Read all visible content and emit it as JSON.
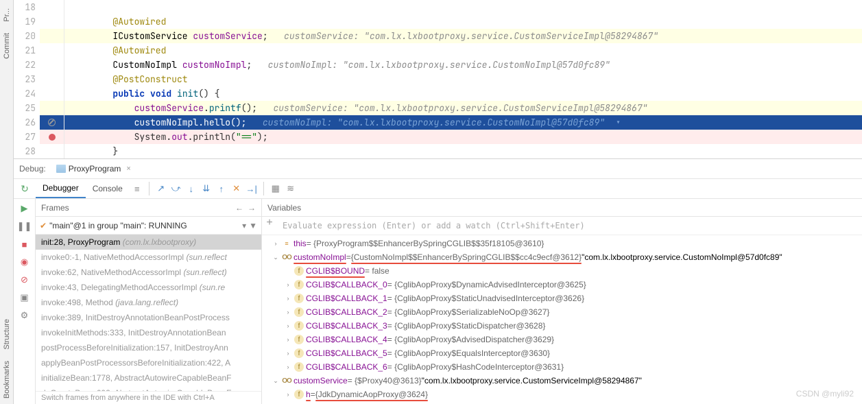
{
  "editor": {
    "lines": [
      {
        "num": "18",
        "html": ""
      },
      {
        "num": "19",
        "html": "        <span class='anno'>@Autowired</span>"
      },
      {
        "num": "20",
        "html": "        <span class='type'>ICustomService</span> <span class='field'>customService</span>;   <span class='comment-hint'>customService: \"com.lx.lxbootproxy.service.CustomServiceImpl@58294867\"</span>",
        "yellow": true
      },
      {
        "num": "21",
        "html": "        <span class='anno'>@Autowired</span>"
      },
      {
        "num": "22",
        "html": "        <span class='type'>CustomNoImpl</span> <span class='field'>customNoImpl</span>;   <span class='comment-hint'>customNoImpl: \"com.lx.lxbootproxy.service.CustomNoImpl@57d0fc89\"</span>"
      },
      {
        "num": "23",
        "html": "        <span class='anno'>@PostConstruct</span>"
      },
      {
        "num": "24",
        "html": "        <span class='kw'>public</span> <span class='kw'>void</span> <span class='mtd'>init</span>() {"
      },
      {
        "num": "25",
        "html": "            <span class='field'>customService</span>.<span class='mtd'>printf</span>();   <span class='comment-hint'>customService: \"com.lx.lxbootproxy.service.CustomServiceImpl@58294867\"</span>",
        "yellow": true
      },
      {
        "num": "26",
        "html": "            <span class='field'>customNoImpl</span>.<span class='mtd'>hello</span>();   <span class='comment-hint'>customNoImpl: \"com.lx.lxbootproxy.service.CustomNoImpl@57d0fc89\"  ▾</span>",
        "hl": true,
        "icon": "noentry"
      },
      {
        "num": "27",
        "html": "            System.<span class='field'>out</span>.println(<span class='str'>\"==\"</span>);",
        "red": true,
        "icon": "bp"
      },
      {
        "num": "28",
        "html": "        }"
      }
    ]
  },
  "sidebar": {
    "top": [
      "Pr...",
      "Commit"
    ],
    "bottom": [
      "Structure",
      "Bookmarks"
    ]
  },
  "debug": {
    "label": "Debug:",
    "tab_name": "ProxyProgram",
    "tabs": {
      "debugger": "Debugger",
      "console": "Console"
    },
    "frames_title": "Frames",
    "vars_title": "Variables",
    "thread": "\"main\"@1 in group \"main\": RUNNING",
    "eval_hint": "Evaluate expression (Enter) or add a watch (Ctrl+Shift+Enter)",
    "frames": [
      {
        "txt": "init:28, ProxyProgram ",
        "pkg": "(com.lx.lxbootproxy)",
        "sel": true
      },
      {
        "txt": "invoke0:-1, NativeMethodAccessorImpl ",
        "pkg": "(sun.reflect",
        "dim": true
      },
      {
        "txt": "invoke:62, NativeMethodAccessorImpl ",
        "pkg": "(sun.reflect)",
        "dim": true
      },
      {
        "txt": "invoke:43, DelegatingMethodAccessorImpl ",
        "pkg": "(sun.re",
        "dim": true
      },
      {
        "txt": "invoke:498, Method ",
        "pkg": "(java.lang.reflect)",
        "dim": true
      },
      {
        "txt": "invoke:389, InitDestroyAnnotationBeanPostProcess",
        "pkg": "",
        "dim": true
      },
      {
        "txt": "invokeInitMethods:333, InitDestroyAnnotationBean",
        "pkg": "",
        "dim": true
      },
      {
        "txt": "postProcessBeforeInitialization:157, InitDestroyAnn",
        "pkg": "",
        "dim": true
      },
      {
        "txt": "applyBeanPostProcessorsBeforeInitialization:422, A",
        "pkg": "",
        "dim": true
      },
      {
        "txt": "initializeBean:1778, AbstractAutowireCapableBeanF",
        "pkg": "",
        "dim": true
      },
      {
        "txt": "doCreateBean:602, AbstractAutowireCapableBeanF",
        "pkg": "",
        "dim": true
      }
    ],
    "frames_hint": "Switch frames from anywhere in the IDE with Ctrl+A",
    "vars": [
      {
        "d": 0,
        "arrow": ">",
        "icon": "eq",
        "name": "this",
        "val": " = {ProxyProgram$$EnhancerBySpringCGLIB$$35f18105@3610}"
      },
      {
        "d": 0,
        "arrow": "v",
        "icon": "oo",
        "name": "customNoImpl",
        "val": " = ",
        "ul": "{CustomNoImpl$$EnhancerBySpringCGLIB$$cc4c9ecf@3612}",
        "str": " \"com.lx.lxbootproxy.service.CustomNoImpl@57d0fc89\"",
        "nameUl": true
      },
      {
        "d": 1,
        "arrow": "",
        "icon": "f",
        "name": "CGLIB$BOUND",
        "val": " = false",
        "nameUl": true
      },
      {
        "d": 1,
        "arrow": ">",
        "icon": "f",
        "name": "CGLIB$CALLBACK_0",
        "val": " = {CglibAopProxy$DynamicAdvisedInterceptor@3625}"
      },
      {
        "d": 1,
        "arrow": ">",
        "icon": "f",
        "name": "CGLIB$CALLBACK_1",
        "val": " = {CglibAopProxy$StaticUnadvisedInterceptor@3626}"
      },
      {
        "d": 1,
        "arrow": ">",
        "icon": "f",
        "name": "CGLIB$CALLBACK_2",
        "val": " = {CglibAopProxy$SerializableNoOp@3627}"
      },
      {
        "d": 1,
        "arrow": ">",
        "icon": "f",
        "name": "CGLIB$CALLBACK_3",
        "val": " = {CglibAopProxy$StaticDispatcher@3628}"
      },
      {
        "d": 1,
        "arrow": ">",
        "icon": "f",
        "name": "CGLIB$CALLBACK_4",
        "val": " = {CglibAopProxy$AdvisedDispatcher@3629}"
      },
      {
        "d": 1,
        "arrow": ">",
        "icon": "f",
        "name": "CGLIB$CALLBACK_5",
        "val": " = {CglibAopProxy$EqualsInterceptor@3630}"
      },
      {
        "d": 1,
        "arrow": ">",
        "icon": "f",
        "name": "CGLIB$CALLBACK_6",
        "val": " = {CglibAopProxy$HashCodeInterceptor@3631}"
      },
      {
        "d": 0,
        "arrow": "v",
        "icon": "oo",
        "name": "customService",
        "val": " = {$Proxy40@3613} ",
        "str": "\"com.lx.lxbootproxy.service.CustomServiceImpl@58294867\""
      },
      {
        "d": 1,
        "arrow": ">",
        "icon": "f",
        "name": "h",
        "val": " = ",
        "ul": "{JdkDynamicAopProxy@3624}",
        "nameUl": true
      }
    ]
  },
  "watermark": "CSDN @myli92"
}
